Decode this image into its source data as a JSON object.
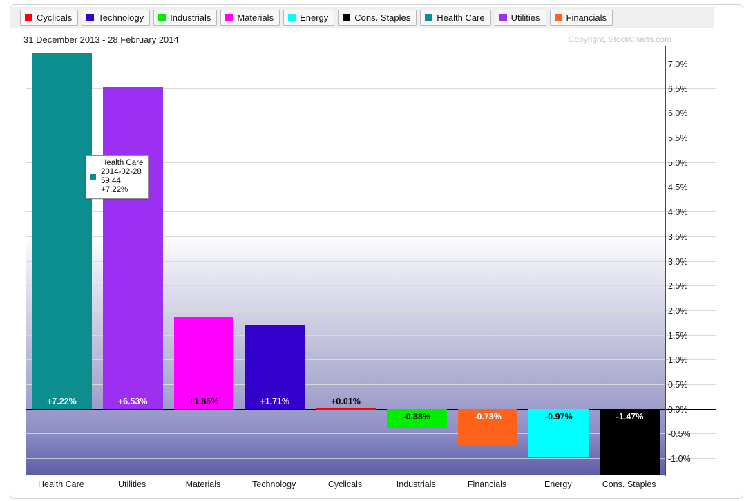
{
  "legend": {
    "items": [
      {
        "label": "Cyclicals",
        "color": "#ff0000",
        "icon": "color-swatch-icon"
      },
      {
        "label": "Technology",
        "color": "#3300cc",
        "icon": "color-swatch-icon"
      },
      {
        "label": "Industrials",
        "color": "#00ee00",
        "icon": "color-swatch-icon"
      },
      {
        "label": "Materials",
        "color": "#ff00ff",
        "icon": "color-swatch-icon"
      },
      {
        "label": "Energy",
        "color": "#00ffff",
        "icon": "color-swatch-icon"
      },
      {
        "label": "Cons. Staples",
        "color": "#000000",
        "icon": "color-swatch-icon"
      },
      {
        "label": "Health Care",
        "color": "#0c8e8e",
        "icon": "color-swatch-icon"
      },
      {
        "label": "Utilities",
        "color": "#9c2ff0",
        "icon": "color-swatch-icon"
      },
      {
        "label": "Financials",
        "color": "#ff6218",
        "icon": "color-swatch-icon"
      }
    ]
  },
  "chart": {
    "title": "31 December 2013 - 28 February 2014",
    "copyright": "Copyright, StockCharts.com"
  },
  "tooltip": {
    "name": "Health Care",
    "date": "2014-02-28",
    "value": "59.44",
    "change": "+7.22%",
    "swatch_color": "#0c8e8e"
  },
  "chart_data": {
    "type": "bar",
    "title": "31 December 2013 - 28 February 2014",
    "xlabel": "",
    "ylabel": "",
    "ylim": [
      -1.35,
      7.35
    ],
    "grid": true,
    "legend_position": "top",
    "orientation": "vertical",
    "value_suffix": "%",
    "categories": [
      "Health Care",
      "Utilities",
      "Materials",
      "Technology",
      "Cyclicals",
      "Industrials",
      "Financials",
      "Energy",
      "Cons. Staples"
    ],
    "values": [
      7.22,
      6.53,
      1.86,
      1.71,
      0.01,
      -0.38,
      -0.73,
      -0.97,
      -1.47
    ],
    "labels": [
      "+7.22%",
      "+6.53%",
      "+1.86%",
      "+1.71%",
      "+0.01%",
      "-0.38%",
      "-0.73%",
      "-0.97%",
      "-1.47%"
    ],
    "colors": [
      "#0c8e8e",
      "#9c2ff0",
      "#ff00ff",
      "#3300cc",
      "#ff0000",
      "#00ee00",
      "#ff6218",
      "#00ffff",
      "#000000"
    ],
    "label_colors": [
      "#ffffff",
      "#ffffff",
      "#000000",
      "#ffffff",
      "#000000",
      "#000000",
      "#ffffff",
      "#000000",
      "#ffffff"
    ],
    "yticks": [
      "7.0%",
      "6.5%",
      "6.0%",
      "5.5%",
      "5.0%",
      "4.5%",
      "4.0%",
      "3.5%",
      "3.0%",
      "2.5%",
      "2.0%",
      "1.5%",
      "1.0%",
      "0.5%",
      "0.0%",
      "-0.5%",
      "-1.0%"
    ],
    "ytick_values": [
      7.0,
      6.5,
      6.0,
      5.5,
      5.0,
      4.5,
      4.0,
      3.5,
      3.0,
      2.5,
      2.0,
      1.5,
      1.0,
      0.5,
      0.0,
      -0.5,
      -1.0
    ]
  }
}
